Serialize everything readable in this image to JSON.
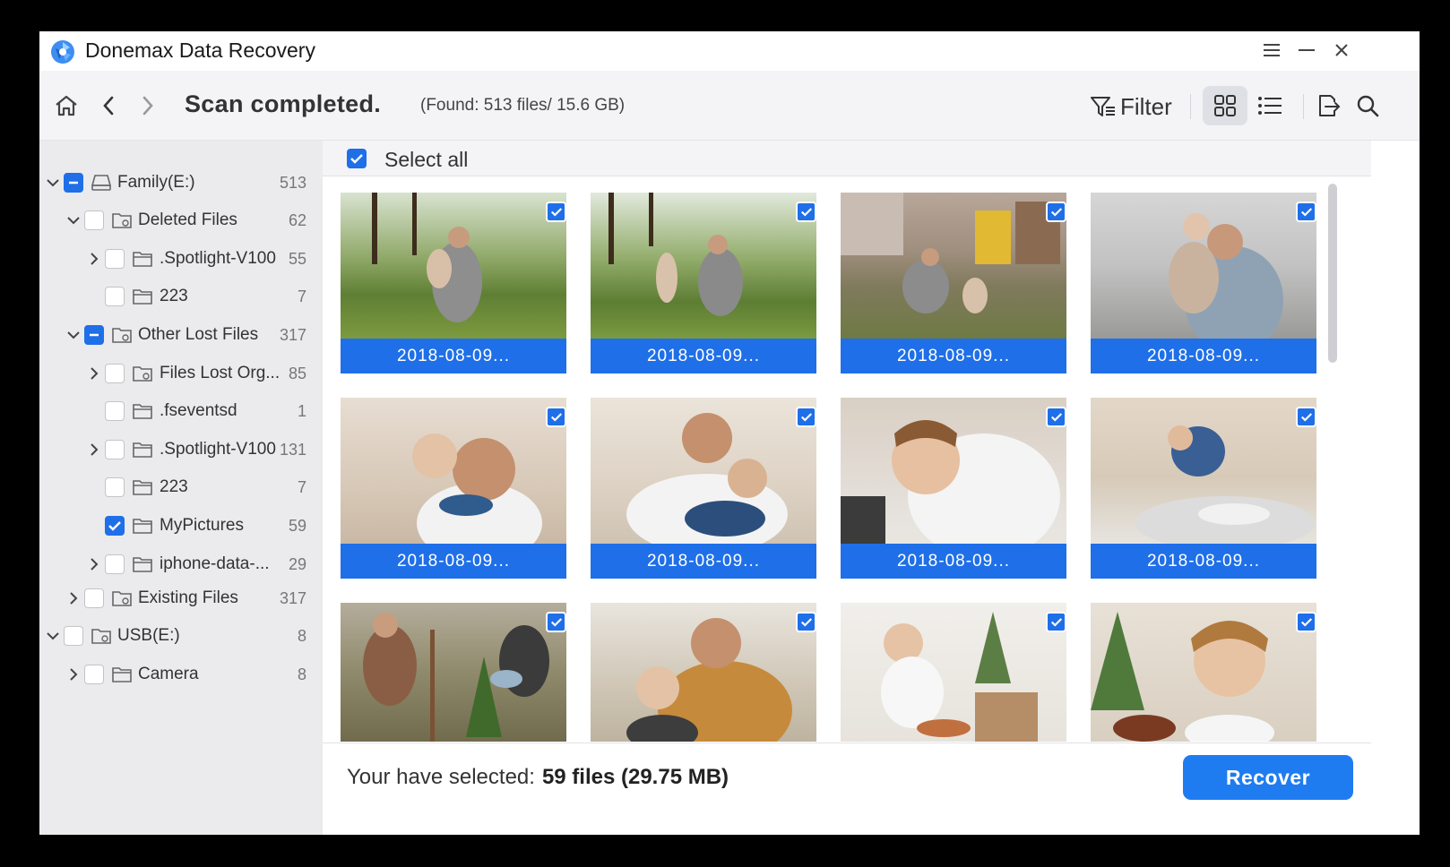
{
  "window": {
    "title": "Donemax Data Recovery"
  },
  "toolbar": {
    "scan_title": "Scan completed.",
    "found_text": "(Found: 513 files/ 15.6 GB)",
    "filter_label": "Filter"
  },
  "sidebar": {
    "items": [
      {
        "label": "Family(E:)",
        "count": "513"
      },
      {
        "label": "Deleted Files",
        "count": "62"
      },
      {
        "label": ".Spotlight-V100",
        "count": "55"
      },
      {
        "label": "223",
        "count": "7"
      },
      {
        "label": "Other Lost Files",
        "count": "317"
      },
      {
        "label": "Files Lost Org...",
        "count": "85"
      },
      {
        "label": ".fseventsd",
        "count": "1"
      },
      {
        "label": ".Spotlight-V100",
        "count": "131"
      },
      {
        "label": "223",
        "count": "7"
      },
      {
        "label": "MyPictures",
        "count": "59"
      },
      {
        "label": "iphone-data-...",
        "count": "29"
      },
      {
        "label": "Existing Files",
        "count": "317"
      },
      {
        "label": "USB(E:)",
        "count": "8"
      },
      {
        "label": "Camera",
        "count": "8"
      }
    ]
  },
  "main": {
    "select_all_label": "Select all",
    "thumbnails": [
      {
        "caption": "2018-08-09..."
      },
      {
        "caption": "2018-08-09..."
      },
      {
        "caption": "2018-08-09..."
      },
      {
        "caption": "2018-08-09..."
      },
      {
        "caption": "2018-08-09..."
      },
      {
        "caption": "2018-08-09..."
      },
      {
        "caption": "2018-08-09..."
      },
      {
        "caption": "2018-08-09..."
      }
    ]
  },
  "footer": {
    "selected_label": "Your have selected:",
    "selected_value": "59 files (29.75 MB)",
    "recover_label": "Recover"
  },
  "colors": {
    "accent": "#1f6fe8",
    "recover": "#1f7cf0",
    "sidebar_bg": "#ebebee"
  }
}
